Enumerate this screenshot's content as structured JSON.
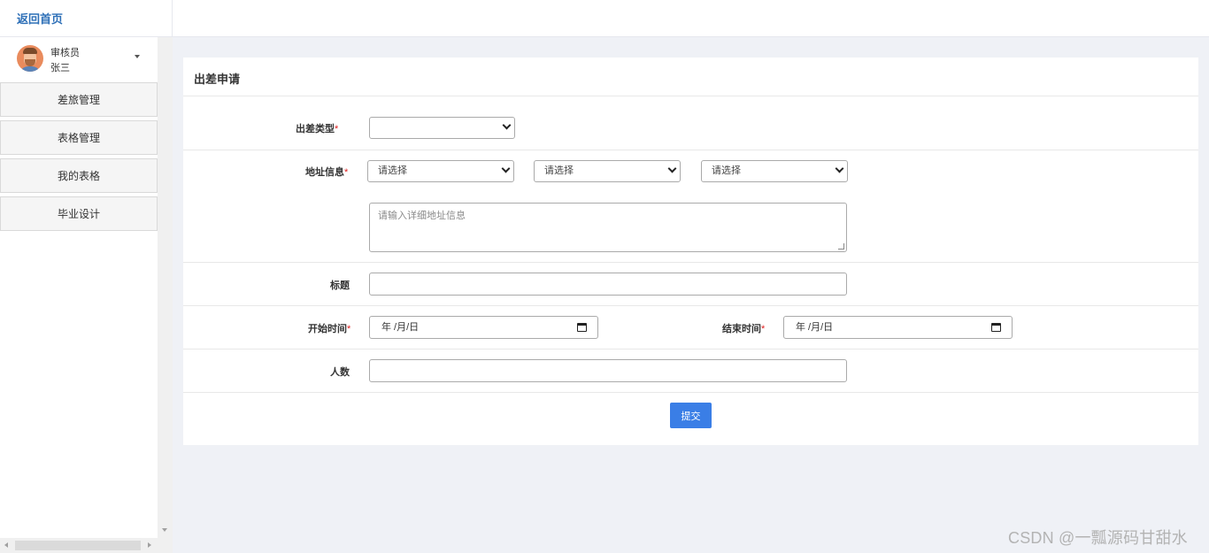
{
  "header": {
    "home_link": "返回首页"
  },
  "user": {
    "role": "审核员",
    "name": "张三"
  },
  "sidebar": {
    "items": [
      {
        "label": "差旅管理"
      },
      {
        "label": "表格管理"
      },
      {
        "label": "我的表格"
      },
      {
        "label": "毕业设计"
      }
    ]
  },
  "form": {
    "title": "出差申请",
    "trip_type": {
      "label": "出差类型",
      "required_mark": "*",
      "value": ""
    },
    "address": {
      "label": "地址信息",
      "required_mark": "*",
      "province": "请选择",
      "city": "请选择",
      "district": "请选择",
      "detail_placeholder": "请输入详细地址信息"
    },
    "subject": {
      "label": "标题",
      "value": ""
    },
    "start_time": {
      "label": "开始时间",
      "required_mark": "*",
      "value": "年 /月/日"
    },
    "end_time": {
      "label": "结束时间",
      "required_mark": "*",
      "value": "年 /月/日"
    },
    "people": {
      "label": "人数",
      "value": ""
    },
    "submit_label": "提交"
  },
  "watermark": "CSDN @一瓢源码甘甜水",
  "colors": {
    "accent": "#3a7ee6",
    "link": "#2d6fb7",
    "required": "#e02020",
    "background": "#eff1f6"
  }
}
